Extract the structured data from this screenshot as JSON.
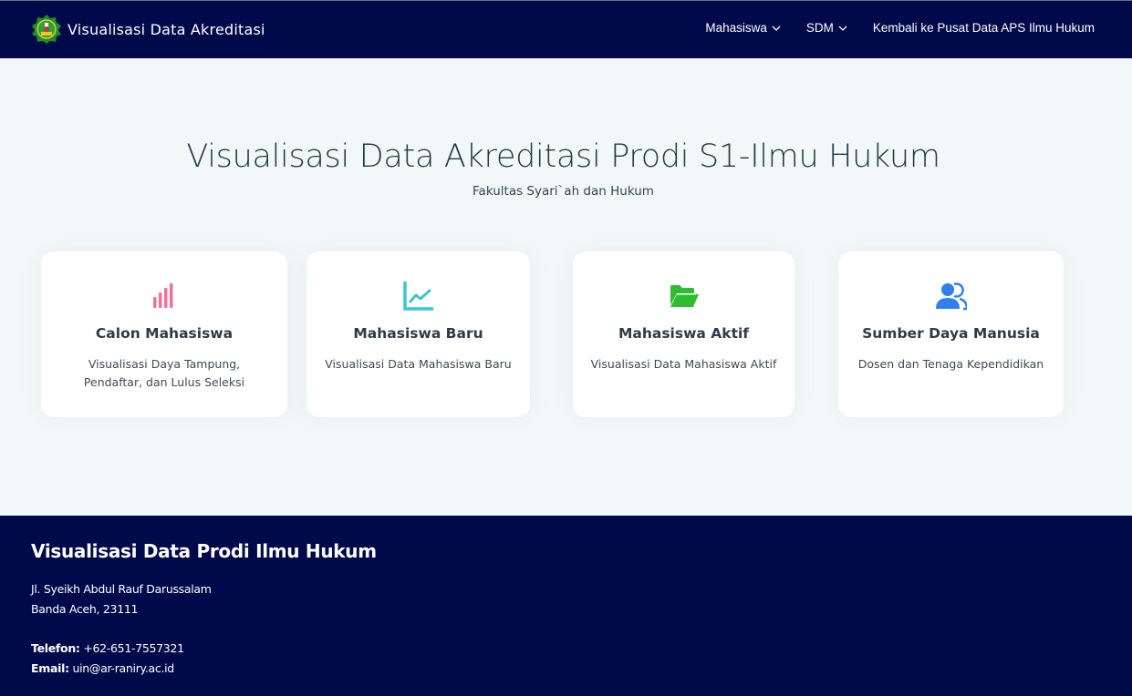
{
  "header": {
    "brand": "Visualisasi Data Akreditasi",
    "nav": {
      "mahasiswa": "Mahasiswa",
      "sdm": "SDM",
      "kembali": "Kembali ke Pusat Data APS Ilmu Hukum"
    }
  },
  "hero": {
    "title": "Visualisasi Data Akreditasi Prodi S1-Ilmu Hukum",
    "subtitle": "Fakultas Syari`ah dan Hukum"
  },
  "cards": [
    {
      "icon": "bar-chart-icon",
      "color": "#f0729a",
      "title": "Calon Mahasiswa",
      "desc": "Visualisasi Daya Tampung, Pendaftar, dan Lulus Seleksi"
    },
    {
      "icon": "line-chart-icon",
      "color": "#3cc6cc",
      "title": "Mahasiswa Baru",
      "desc": "Visualisasi Data Mahasiswa Baru"
    },
    {
      "icon": "folder-open-icon",
      "color": "#2ebd2e",
      "title": "Mahasiswa Aktif",
      "desc": "Visualisasi Data Mahasiswa Aktif"
    },
    {
      "icon": "people-icon",
      "color": "#2f80ed",
      "title": "Sumber Daya Manusia",
      "desc": "Dosen dan Tenaga Kependidikan"
    }
  ],
  "footer": {
    "title": "Visualisasi Data Prodi Ilmu Hukum",
    "address_line1": "Jl. Syeikh Abdul Rauf Darussalam",
    "address_line2": "Banda Aceh, 23111",
    "phone_label": "Telefon:",
    "phone": "+62-651-7557321",
    "email_label": "Email:",
    "email": "uin@ar-raniry.ac.id"
  },
  "colors": {
    "navbar": "#000a4a",
    "background": "#f2f8f8"
  }
}
